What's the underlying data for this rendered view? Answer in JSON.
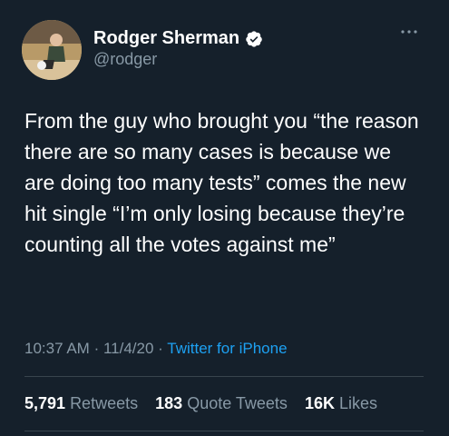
{
  "author": {
    "name": "Rodger Sherman",
    "handle": "@rodger"
  },
  "tweet": {
    "text": "From the guy who brought you “the reason there are so many cases is because we are doing too many tests” comes the new hit single “I’m only losing because they’re counting all the votes against me”",
    "time": "10:37 AM",
    "date": "11/4/20",
    "separator": "·",
    "source": "Twitter for iPhone"
  },
  "stats": {
    "retweets_count": "5,791",
    "retweets_label": "Retweets",
    "quotes_count": "183",
    "quotes_label": "Quote Tweets",
    "likes_count": "16K",
    "likes_label": "Likes"
  },
  "colors": {
    "background": "#15202b",
    "secondary_text": "#8899a6",
    "link": "#1da1f2",
    "divider": "#38444d"
  },
  "icons": [
    "verified-badge-icon",
    "more-options-icon"
  ]
}
